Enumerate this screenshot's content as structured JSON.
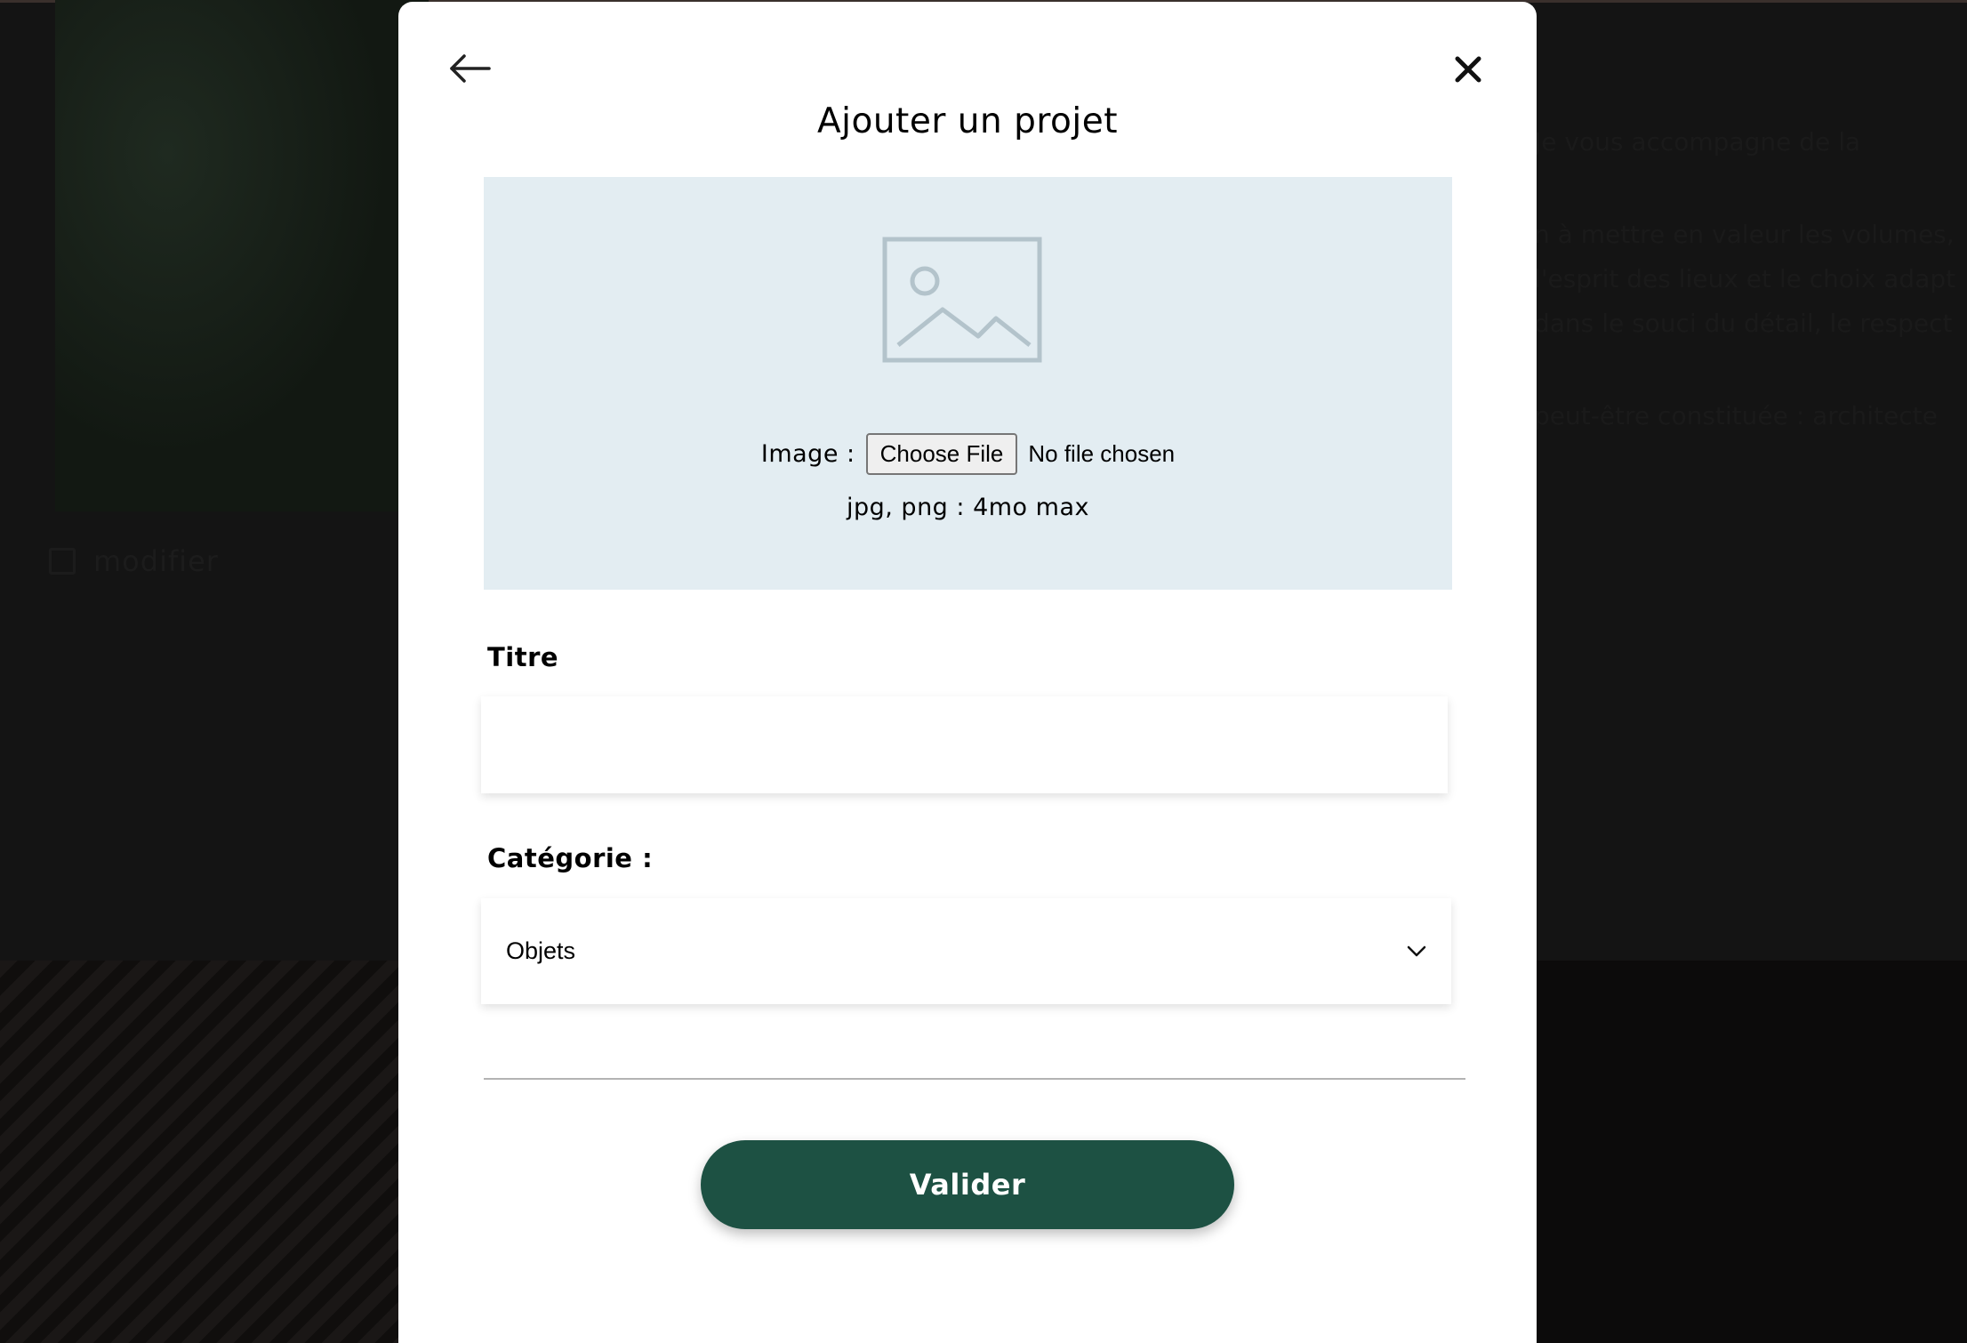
{
  "background": {
    "edit_label": "modifier",
    "text_lines": [
      "Je vous accompagne de la",
      "n à mettre en valeur les volumes,",
      "l'esprit des lieux et le choix adapt",
      "dans le souci du détail, le respect",
      "peut-être constituée : architecte"
    ]
  },
  "modal": {
    "title": "Ajouter un projet",
    "back_icon": "arrow-left-icon",
    "close_icon": "close-icon",
    "upload": {
      "placeholder_icon": "image-placeholder-icon",
      "image_label": "Image :",
      "choose_button": "Choose File",
      "no_file": "No file chosen",
      "hint": "jpg, png : 4mo max"
    },
    "title_field": {
      "label": "Titre",
      "value": ""
    },
    "category_field": {
      "label": "Catégorie :",
      "selected": "Objets"
    },
    "submit_label": "Valider"
  },
  "colors": {
    "accent": "#1d5143",
    "upload_bg": "#e3edf2",
    "overlay": "#141414"
  }
}
